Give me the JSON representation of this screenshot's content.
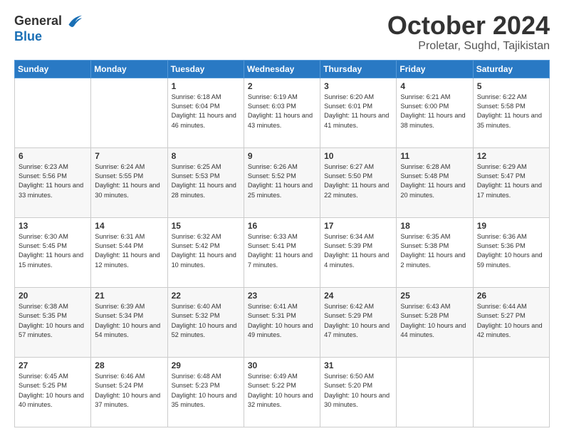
{
  "header": {
    "logo_line1": "General",
    "logo_line2": "Blue",
    "month": "October 2024",
    "location": "Proletar, Sughd, Tajikistan"
  },
  "weekdays": [
    "Sunday",
    "Monday",
    "Tuesday",
    "Wednesday",
    "Thursday",
    "Friday",
    "Saturday"
  ],
  "weeks": [
    [
      {
        "day": null,
        "sunrise": null,
        "sunset": null,
        "daylight": null
      },
      {
        "day": null,
        "sunrise": null,
        "sunset": null,
        "daylight": null
      },
      {
        "day": "1",
        "sunrise": "Sunrise: 6:18 AM",
        "sunset": "Sunset: 6:04 PM",
        "daylight": "Daylight: 11 hours and 46 minutes."
      },
      {
        "day": "2",
        "sunrise": "Sunrise: 6:19 AM",
        "sunset": "Sunset: 6:03 PM",
        "daylight": "Daylight: 11 hours and 43 minutes."
      },
      {
        "day": "3",
        "sunrise": "Sunrise: 6:20 AM",
        "sunset": "Sunset: 6:01 PM",
        "daylight": "Daylight: 11 hours and 41 minutes."
      },
      {
        "day": "4",
        "sunrise": "Sunrise: 6:21 AM",
        "sunset": "Sunset: 6:00 PM",
        "daylight": "Daylight: 11 hours and 38 minutes."
      },
      {
        "day": "5",
        "sunrise": "Sunrise: 6:22 AM",
        "sunset": "Sunset: 5:58 PM",
        "daylight": "Daylight: 11 hours and 35 minutes."
      }
    ],
    [
      {
        "day": "6",
        "sunrise": "Sunrise: 6:23 AM",
        "sunset": "Sunset: 5:56 PM",
        "daylight": "Daylight: 11 hours and 33 minutes."
      },
      {
        "day": "7",
        "sunrise": "Sunrise: 6:24 AM",
        "sunset": "Sunset: 5:55 PM",
        "daylight": "Daylight: 11 hours and 30 minutes."
      },
      {
        "day": "8",
        "sunrise": "Sunrise: 6:25 AM",
        "sunset": "Sunset: 5:53 PM",
        "daylight": "Daylight: 11 hours and 28 minutes."
      },
      {
        "day": "9",
        "sunrise": "Sunrise: 6:26 AM",
        "sunset": "Sunset: 5:52 PM",
        "daylight": "Daylight: 11 hours and 25 minutes."
      },
      {
        "day": "10",
        "sunrise": "Sunrise: 6:27 AM",
        "sunset": "Sunset: 5:50 PM",
        "daylight": "Daylight: 11 hours and 22 minutes."
      },
      {
        "day": "11",
        "sunrise": "Sunrise: 6:28 AM",
        "sunset": "Sunset: 5:48 PM",
        "daylight": "Daylight: 11 hours and 20 minutes."
      },
      {
        "day": "12",
        "sunrise": "Sunrise: 6:29 AM",
        "sunset": "Sunset: 5:47 PM",
        "daylight": "Daylight: 11 hours and 17 minutes."
      }
    ],
    [
      {
        "day": "13",
        "sunrise": "Sunrise: 6:30 AM",
        "sunset": "Sunset: 5:45 PM",
        "daylight": "Daylight: 11 hours and 15 minutes."
      },
      {
        "day": "14",
        "sunrise": "Sunrise: 6:31 AM",
        "sunset": "Sunset: 5:44 PM",
        "daylight": "Daylight: 11 hours and 12 minutes."
      },
      {
        "day": "15",
        "sunrise": "Sunrise: 6:32 AM",
        "sunset": "Sunset: 5:42 PM",
        "daylight": "Daylight: 11 hours and 10 minutes."
      },
      {
        "day": "16",
        "sunrise": "Sunrise: 6:33 AM",
        "sunset": "Sunset: 5:41 PM",
        "daylight": "Daylight: 11 hours and 7 minutes."
      },
      {
        "day": "17",
        "sunrise": "Sunrise: 6:34 AM",
        "sunset": "Sunset: 5:39 PM",
        "daylight": "Daylight: 11 hours and 4 minutes."
      },
      {
        "day": "18",
        "sunrise": "Sunrise: 6:35 AM",
        "sunset": "Sunset: 5:38 PM",
        "daylight": "Daylight: 11 hours and 2 minutes."
      },
      {
        "day": "19",
        "sunrise": "Sunrise: 6:36 AM",
        "sunset": "Sunset: 5:36 PM",
        "daylight": "Daylight: 10 hours and 59 minutes."
      }
    ],
    [
      {
        "day": "20",
        "sunrise": "Sunrise: 6:38 AM",
        "sunset": "Sunset: 5:35 PM",
        "daylight": "Daylight: 10 hours and 57 minutes."
      },
      {
        "day": "21",
        "sunrise": "Sunrise: 6:39 AM",
        "sunset": "Sunset: 5:34 PM",
        "daylight": "Daylight: 10 hours and 54 minutes."
      },
      {
        "day": "22",
        "sunrise": "Sunrise: 6:40 AM",
        "sunset": "Sunset: 5:32 PM",
        "daylight": "Daylight: 10 hours and 52 minutes."
      },
      {
        "day": "23",
        "sunrise": "Sunrise: 6:41 AM",
        "sunset": "Sunset: 5:31 PM",
        "daylight": "Daylight: 10 hours and 49 minutes."
      },
      {
        "day": "24",
        "sunrise": "Sunrise: 6:42 AM",
        "sunset": "Sunset: 5:29 PM",
        "daylight": "Daylight: 10 hours and 47 minutes."
      },
      {
        "day": "25",
        "sunrise": "Sunrise: 6:43 AM",
        "sunset": "Sunset: 5:28 PM",
        "daylight": "Daylight: 10 hours and 44 minutes."
      },
      {
        "day": "26",
        "sunrise": "Sunrise: 6:44 AM",
        "sunset": "Sunset: 5:27 PM",
        "daylight": "Daylight: 10 hours and 42 minutes."
      }
    ],
    [
      {
        "day": "27",
        "sunrise": "Sunrise: 6:45 AM",
        "sunset": "Sunset: 5:25 PM",
        "daylight": "Daylight: 10 hours and 40 minutes."
      },
      {
        "day": "28",
        "sunrise": "Sunrise: 6:46 AM",
        "sunset": "Sunset: 5:24 PM",
        "daylight": "Daylight: 10 hours and 37 minutes."
      },
      {
        "day": "29",
        "sunrise": "Sunrise: 6:48 AM",
        "sunset": "Sunset: 5:23 PM",
        "daylight": "Daylight: 10 hours and 35 minutes."
      },
      {
        "day": "30",
        "sunrise": "Sunrise: 6:49 AM",
        "sunset": "Sunset: 5:22 PM",
        "daylight": "Daylight: 10 hours and 32 minutes."
      },
      {
        "day": "31",
        "sunrise": "Sunrise: 6:50 AM",
        "sunset": "Sunset: 5:20 PM",
        "daylight": "Daylight: 10 hours and 30 minutes."
      },
      {
        "day": null,
        "sunrise": null,
        "sunset": null,
        "daylight": null
      },
      {
        "day": null,
        "sunrise": null,
        "sunset": null,
        "daylight": null
      }
    ]
  ]
}
